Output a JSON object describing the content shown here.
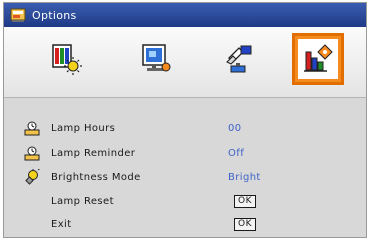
{
  "window": {
    "title": "Options"
  },
  "tabs": [
    {
      "name": "image-settings",
      "icon": "image-color-icon",
      "active": false
    },
    {
      "name": "display",
      "icon": "display-screen-icon",
      "active": false
    },
    {
      "name": "setup",
      "icon": "setup-hand-icon",
      "active": false
    },
    {
      "name": "options",
      "icon": "options-chart-icon",
      "active": true
    }
  ],
  "menu": {
    "lamp_hours": {
      "label": "Lamp Hours",
      "value": "00",
      "icon": "lamp-icon"
    },
    "lamp_reminder": {
      "label": "Lamp Reminder",
      "value": "Off",
      "icon": "lamp-icon"
    },
    "brightness_mode": {
      "label": "Brightness Mode",
      "value": "Bright",
      "icon": "bulb-icon"
    },
    "lamp_reset": {
      "label": "Lamp Reset",
      "button": "OK"
    },
    "exit": {
      "label": "Exit",
      "button": "OK"
    }
  },
  "colors": {
    "title_bar": "#2a4a9c",
    "active_tab": "#f58a1f",
    "value_text": "#3c63c8",
    "panel_bg": "#d8d8d8"
  }
}
